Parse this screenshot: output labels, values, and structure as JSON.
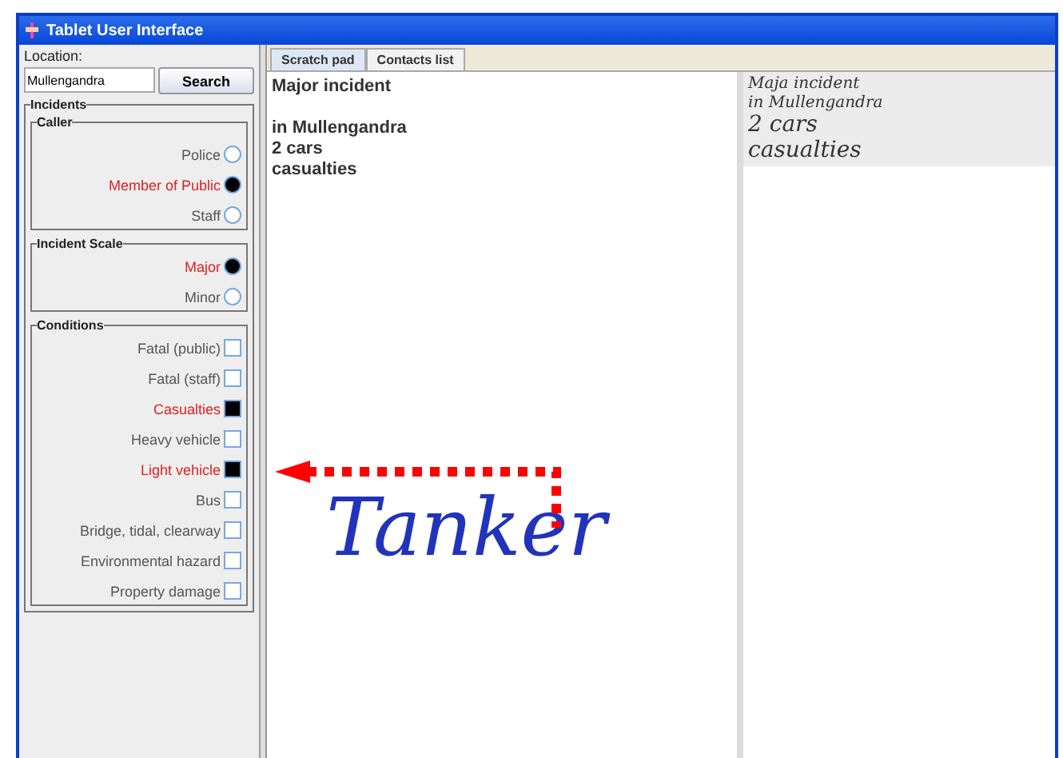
{
  "window": {
    "title": "Tablet User Interface"
  },
  "location": {
    "label": "Location:",
    "value": "Mullengandra",
    "button": "Search"
  },
  "incidents": {
    "title": "Incidents",
    "groups": [
      {
        "title": "Caller",
        "kind": "radio",
        "options": [
          {
            "label": "Police",
            "selected": false
          },
          {
            "label": "Member of Public",
            "selected": true
          },
          {
            "label": "Staff",
            "selected": false
          }
        ]
      },
      {
        "title": "Incident Scale",
        "kind": "radio",
        "options": [
          {
            "label": "Major",
            "selected": true
          },
          {
            "label": "Minor",
            "selected": false
          }
        ]
      },
      {
        "title": "Conditions",
        "kind": "checkbox",
        "options": [
          {
            "label": "Fatal (public)",
            "checked": false
          },
          {
            "label": "Fatal (staff)",
            "checked": false
          },
          {
            "label": "Casualties",
            "checked": true
          },
          {
            "label": "Heavy vehicle",
            "checked": false
          },
          {
            "label": "Light vehicle",
            "checked": true
          },
          {
            "label": "Bus",
            "checked": false
          },
          {
            "label": "Bridge, tidal, clearway",
            "checked": false
          },
          {
            "label": "Environmental hazard",
            "checked": false
          },
          {
            "label": "Property damage",
            "checked": false
          }
        ]
      }
    ]
  },
  "tabs": [
    {
      "label": "Scratch pad",
      "selected": true
    },
    {
      "label": "Contacts list",
      "selected": false
    }
  ],
  "scratch_pad": {
    "lines": [
      "Major incident",
      "in Mullengandra",
      "2 cars",
      "casualties"
    ],
    "ink": "Tanker"
  },
  "recognized_ink": {
    "lines": [
      "Maja incident",
      "in Mullengandra",
      "2 cars",
      "casualties"
    ]
  }
}
